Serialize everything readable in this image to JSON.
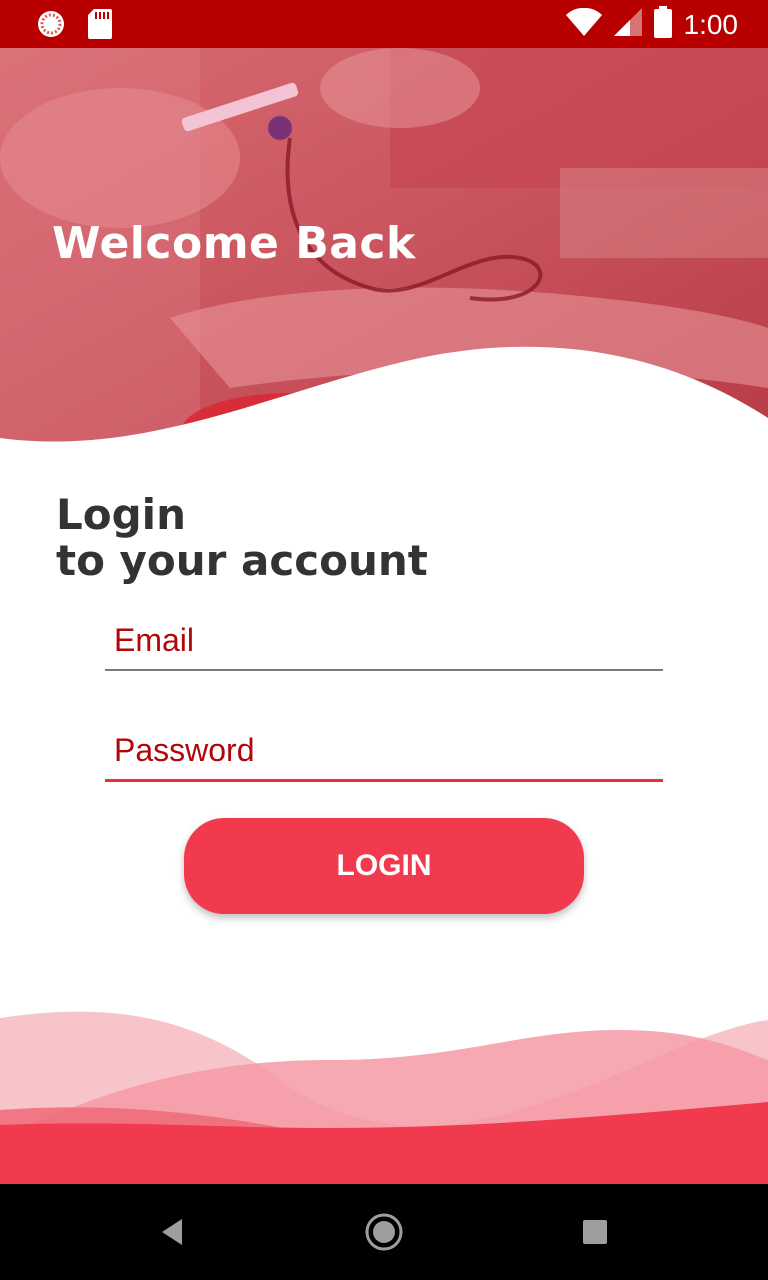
{
  "status_bar": {
    "time": "1:00",
    "left_icons": [
      "spinner-icon",
      "sd-card-icon"
    ],
    "right_icons": [
      "wifi-icon",
      "signal-icon",
      "battery-icon"
    ]
  },
  "hero": {
    "title": "Welcome Back"
  },
  "heading": {
    "line1": "Login",
    "line2": "to your account"
  },
  "form": {
    "email_placeholder": "Email",
    "password_placeholder": "Password",
    "login_label": "LOGIN"
  },
  "nav": {
    "icons": [
      "back-icon",
      "home-icon",
      "recent-apps-icon"
    ]
  },
  "colors": {
    "status_bar": "#b80000",
    "accent": "#f23a4f",
    "field_text": "#b3060b",
    "heading_text": "#333333"
  }
}
